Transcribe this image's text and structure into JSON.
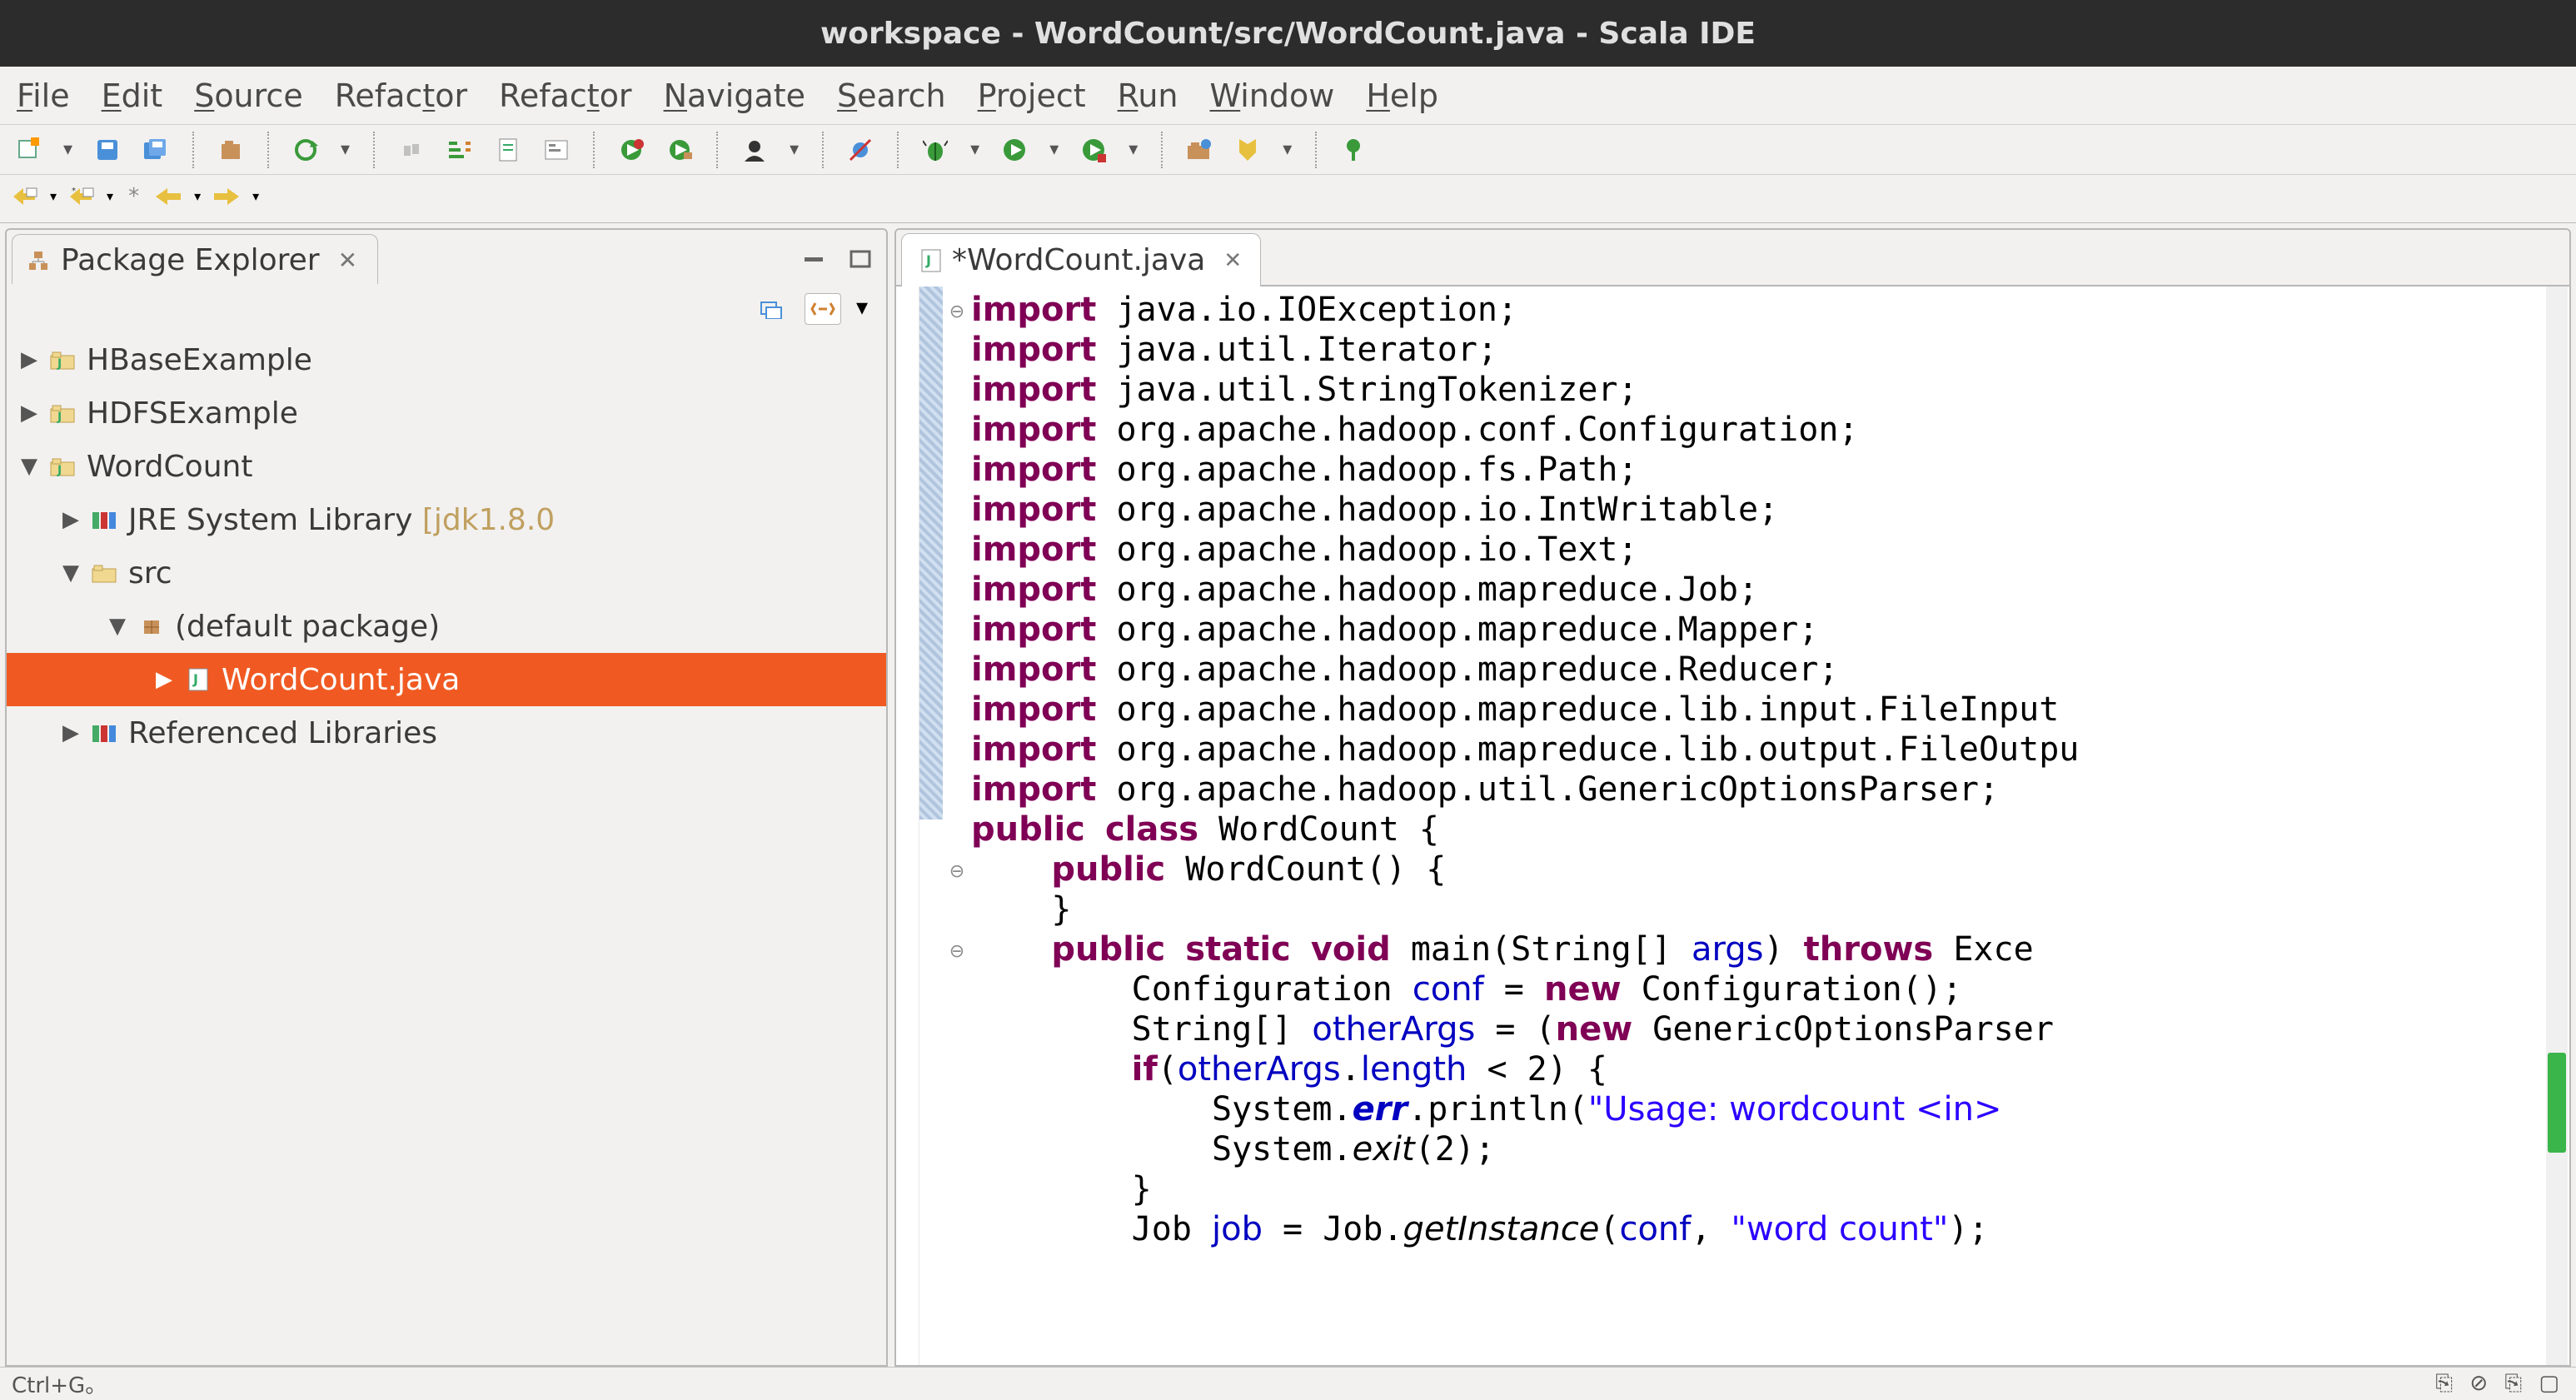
{
  "title": "workspace - WordCount/src/WordCount.java - Scala IDE",
  "menu": [
    "File",
    "Edit",
    "Source",
    "Refactor",
    "Refactor",
    "Navigate",
    "Search",
    "Project",
    "Run",
    "Window",
    "Help"
  ],
  "menu_ul": [
    0,
    0,
    0,
    5,
    5,
    0,
    0,
    0,
    0,
    0,
    0
  ],
  "packageExplorer": {
    "title": "Package Explorer",
    "tree": [
      {
        "depth": 0,
        "expand": "▶",
        "icon": "proj",
        "label": "HBaseExample"
      },
      {
        "depth": 0,
        "expand": "▶",
        "icon": "proj",
        "label": "HDFSExample"
      },
      {
        "depth": 0,
        "expand": "▼",
        "icon": "proj",
        "label": "WordCount"
      },
      {
        "depth": 1,
        "expand": "▶",
        "icon": "lib",
        "label": "JRE System Library ",
        "dim": "[jdk1.8.0"
      },
      {
        "depth": 1,
        "expand": "▼",
        "icon": "folder",
        "label": "src"
      },
      {
        "depth": 2,
        "expand": "▼",
        "icon": "pkg",
        "label": "(default package)"
      },
      {
        "depth": 3,
        "expand": "▶",
        "icon": "java",
        "label": "WordCount.java",
        "selected": true
      },
      {
        "depth": 1,
        "expand": "▶",
        "icon": "lib",
        "label": "Referenced Libraries"
      }
    ]
  },
  "editor": {
    "tab": "*WordCount.java",
    "code_html": "<span class=\"kw\">import</span> java.io.IOException;\n<span class=\"kw\">import</span> java.util.Iterator;\n<span class=\"kw\">import</span> java.util.StringTokenizer;\n<span class=\"kw\">import</span> org.apache.hadoop.conf.Configuration;\n<span class=\"kw\">import</span> org.apache.hadoop.fs.Path;\n<span class=\"kw\">import</span> org.apache.hadoop.io.IntWritable;\n<span class=\"kw\">import</span> org.apache.hadoop.io.Text;\n<span class=\"kw\">import</span> org.apache.hadoop.mapreduce.Job;\n<span class=\"kw\">import</span> org.apache.hadoop.mapreduce.Mapper;\n<span class=\"kw\">import</span> org.apache.hadoop.mapreduce.Reducer;\n<span class=\"kw\">import</span> org.apache.hadoop.mapreduce.lib.input.FileInput\n<span class=\"kw\">import</span> org.apache.hadoop.mapreduce.lib.output.FileOutpu\n<span class=\"kw\">import</span> org.apache.hadoop.util.GenericOptionsParser;\n<span class=\"kw\">public</span> <span class=\"kw\">class</span> WordCount {\n    <span class=\"kw\">public</span> WordCount() {\n    }\n    <span class=\"kw\">public</span> <span class=\"kw\">static</span> <span class=\"kw\">void</span> main(String[] <span class=\"fld\">args</span>) <span class=\"kw\">throws</span> Exce\n        Configuration <span class=\"fld\">conf</span> = <span class=\"kw\">new</span> Configuration();\n        String[] <span class=\"fld\">otherArgs</span> = (<span class=\"kw\">new</span> GenericOptionsParser\n        <span class=\"kw\">if</span>(<span class=\"fld\">otherArgs</span>.<span class=\"fld\">length</span> &lt; 2) {\n            System.<span class=\"field-it bold\">err</span>.println(<span class=\"str\">\"Usage: wordcount &lt;in&gt; </span>\n            System.<span style=\"font-style:italic\">exit</span>(2);\n        }\n        Job <span class=\"fld\">job</span> = Job.<span style=\"font-style:italic\">getInstance</span>(<span class=\"fld\">conf</span>, <span class=\"str\">\"word count\"</span>);"
  },
  "status": {
    "left": "Ctrl+G。"
  }
}
